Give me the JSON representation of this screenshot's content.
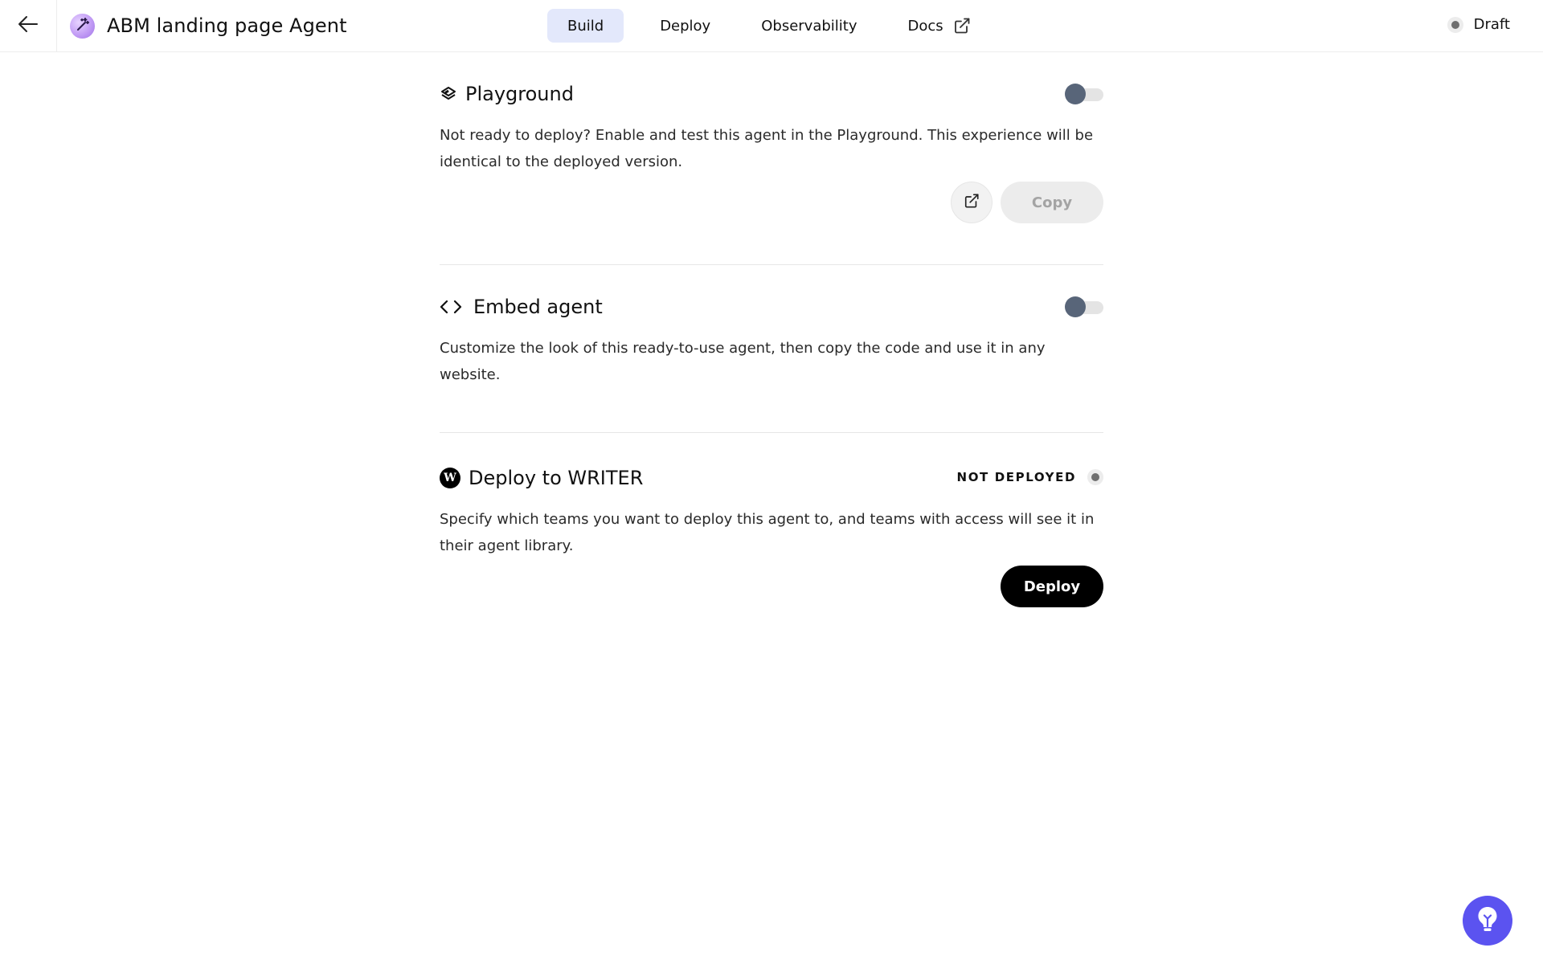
{
  "header": {
    "agent_title": "ABM landing page Agent",
    "status_label": "Draft",
    "tabs": [
      {
        "label": "Build",
        "active": true
      },
      {
        "label": "Deploy",
        "active": false
      },
      {
        "label": "Observability",
        "active": false
      },
      {
        "label": "Docs",
        "active": false,
        "external": true
      }
    ]
  },
  "playground": {
    "title": "Playground",
    "description": "Not ready to deploy? Enable and test this agent in the Playground. This experience will be identical to the deployed version.",
    "enabled": false,
    "copy_label": "Copy"
  },
  "embed": {
    "title": "Embed agent",
    "description": "Customize the look of this ready-to-use agent, then copy the code and use it in any website.",
    "enabled": false
  },
  "writer_deploy": {
    "title": "Deploy to WRITER",
    "status": "NOT DEPLOYED",
    "description": "Specify which teams you want to deploy this agent to, and teams with access will see it in their agent library.",
    "deploy_label": "Deploy",
    "logo_letter": "W"
  },
  "colors": {
    "active_tab_bg": "#e3e8fb",
    "toggle_knob": "#586579",
    "primary_button": "#000000",
    "help_fab": "#5b53f0"
  }
}
